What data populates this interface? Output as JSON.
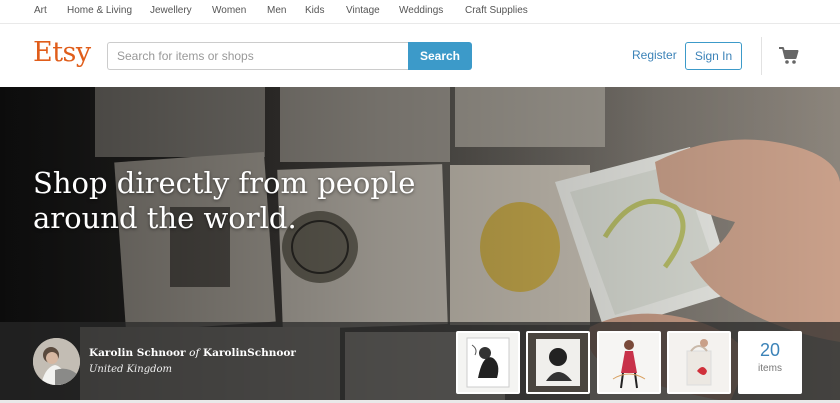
{
  "nav": {
    "categories": [
      "Art",
      "Home & Living",
      "Jewellery",
      "Women",
      "Men",
      "Kids",
      "Vintage",
      "Weddings",
      "Craft Supplies"
    ]
  },
  "header": {
    "logo": "Etsy",
    "search_placeholder": "Search for items or shops",
    "search_button": "Search",
    "register": "Register",
    "sign_in": "Sign In",
    "cart_icon": "cart-icon"
  },
  "hero": {
    "headline": "Shop directly from people around the world."
  },
  "seller": {
    "name": "Karolin Schnoor",
    "of": "of",
    "shop": "KarolinSchnoor",
    "location": "United Kingdom",
    "item_count": "20",
    "item_count_label": "items"
  },
  "colors": {
    "brand": "#e05d1a",
    "accent": "#3c9ac9",
    "link": "#3c83b8"
  }
}
